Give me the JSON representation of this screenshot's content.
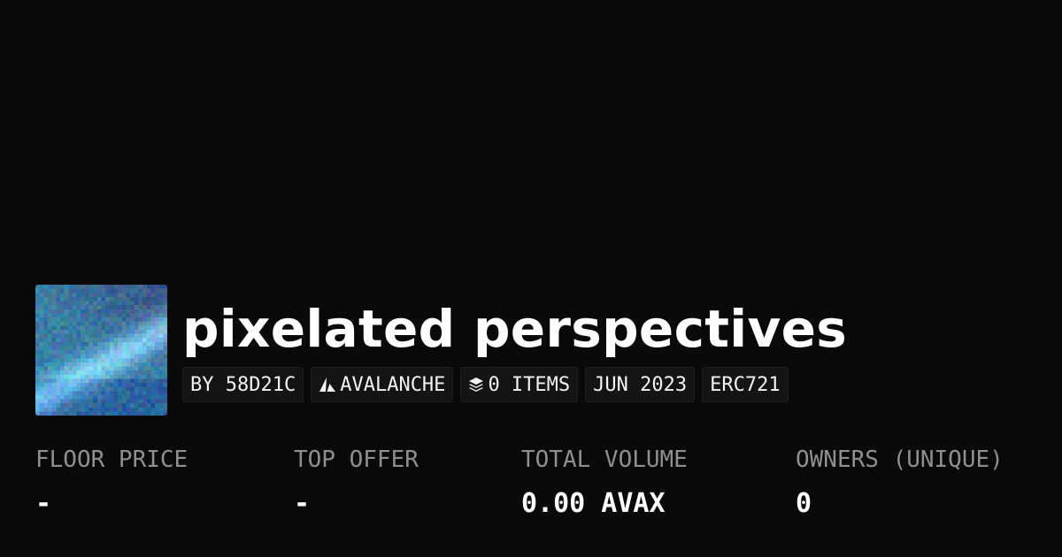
{
  "collection": {
    "thumbnail_icon": "pixel-art-image",
    "title": "pixelated perspectives",
    "tags": [
      {
        "label": "BY 58D21C",
        "icon": null
      },
      {
        "label": "AVALANCHE",
        "icon": "avalanche-icon"
      },
      {
        "label": "0 ITEMS",
        "icon": "layers-icon"
      },
      {
        "label": "JUN 2023",
        "icon": null
      },
      {
        "label": "ERC721",
        "icon": null
      }
    ]
  },
  "stats": [
    {
      "label": "FLOOR PRICE",
      "value": "-"
    },
    {
      "label": "TOP OFFER",
      "value": "-"
    },
    {
      "label": "TOTAL VOLUME",
      "value": "0.00 AVAX"
    },
    {
      "label": "OWNERS (UNIQUE)",
      "value": "0"
    }
  ],
  "colors": {
    "background": "#0a0a0a",
    "tag_background": "#141414",
    "label_gray": "#8f8f8f",
    "text_white": "#ffffff"
  }
}
